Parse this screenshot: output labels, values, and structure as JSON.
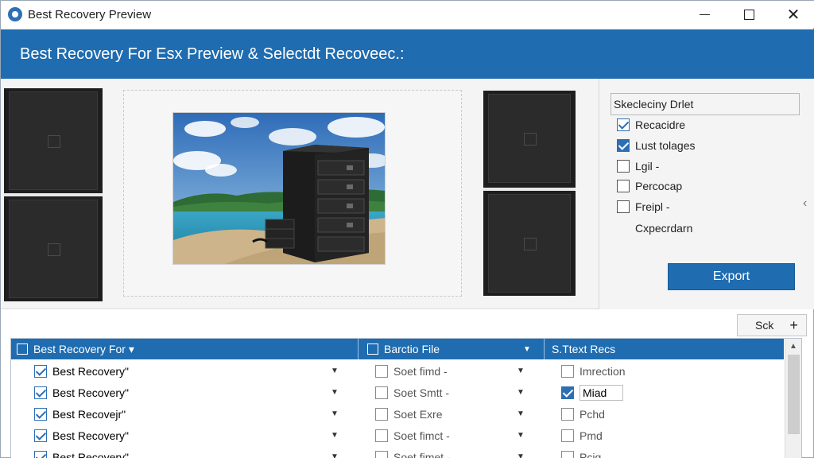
{
  "window": {
    "title": "Best Recovery Preview",
    "controls": {
      "minimize": "",
      "maximize": "",
      "close": "✕"
    }
  },
  "header": {
    "title": "Best Recovery For Esx Preview & Selectdt Recoveec.:"
  },
  "options": {
    "heading": "Skecleciny Drlet",
    "items": [
      {
        "label": "Recacidre",
        "checked": true
      },
      {
        "label": "Lust tolages",
        "checked": true
      },
      {
        "label": "Lgil -",
        "checked": false
      },
      {
        "label": "Percocap",
        "checked": false
      },
      {
        "label": "Freipl -",
        "checked": false
      }
    ],
    "extra_label": "Cxpecrdarn",
    "export_label": "Export",
    "collapse_icon": "chevron-left-icon"
  },
  "mini_toolbar": {
    "label": "Sck",
    "add": "+"
  },
  "table": {
    "headers": [
      {
        "label": "Best Recovery For ▾"
      },
      {
        "label": "Barctio File"
      },
      {
        "label": "S.Ttext Recs"
      }
    ],
    "rows": [
      {
        "col1": "Best Recovery\"",
        "col2": "Soet fimd -",
        "col3": "Imrection",
        "col1_checked": true,
        "col3_checked": false
      },
      {
        "col1": "Best Recovery\"",
        "col2": "Soet Smtt -",
        "col3": "Miad",
        "col1_checked": true,
        "col3_checked": true
      },
      {
        "col1": "Best Recovejr\"",
        "col2": "Soet Exre",
        "col3": "Pchd",
        "col1_checked": true,
        "col3_checked": false
      },
      {
        "col1": "Best Recovery\"",
        "col2": "Soet fimct -",
        "col3": "Pmd",
        "col1_checked": true,
        "col3_checked": false
      },
      {
        "col1": "Best Recovery\"",
        "col2": "Soet fimet -",
        "col3": "Pcig",
        "col1_checked": true,
        "col3_checked": false
      }
    ]
  },
  "colors": {
    "accent": "#1f6cb0",
    "background": "#f4f4f4"
  }
}
